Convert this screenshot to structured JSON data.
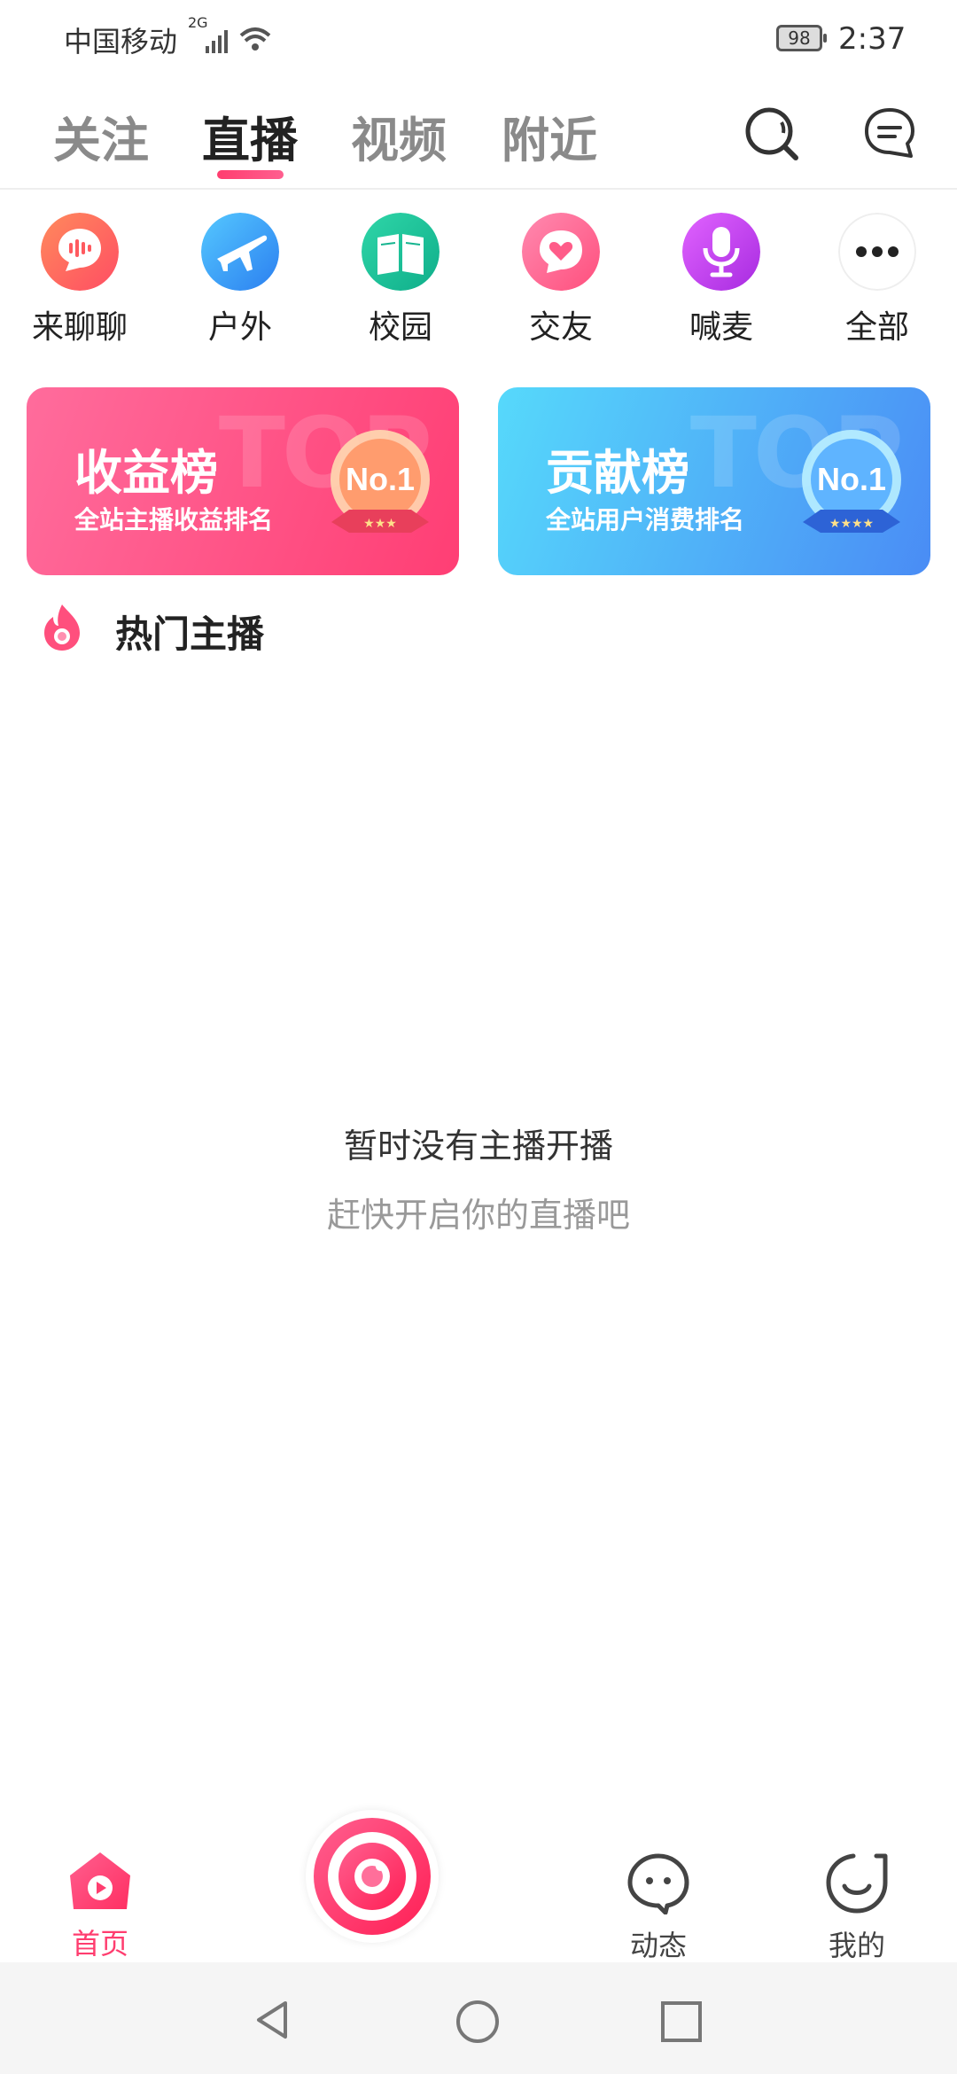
{
  "status_bar": {
    "carrier": "中国移动",
    "network": "2G",
    "battery": "98",
    "time": "2:37"
  },
  "top_nav": {
    "tabs": [
      {
        "label": "关注",
        "active": false
      },
      {
        "label": "直播",
        "active": true
      },
      {
        "label": "视频",
        "active": false
      },
      {
        "label": "附近",
        "active": false
      }
    ]
  },
  "categories": [
    {
      "label": "来聊聊",
      "icon": "chat-voice-icon",
      "color": "#ff6d4f"
    },
    {
      "label": "户外",
      "icon": "airplane-icon",
      "color": "#2e9cf5"
    },
    {
      "label": "校园",
      "icon": "book-icon",
      "color": "#18c29a"
    },
    {
      "label": "交友",
      "icon": "heart-chat-icon",
      "color": "#ff5c89"
    },
    {
      "label": "喊麦",
      "icon": "microphone-icon",
      "color": "#c53ef0"
    },
    {
      "label": "全部",
      "icon": "more-icon",
      "color": "#222222"
    }
  ],
  "banners": [
    {
      "title": "收益榜",
      "subtitle": "全站主播收益排名",
      "badge": "No.1",
      "watermark": "TOP"
    },
    {
      "title": "贡献榜",
      "subtitle": "全站用户消费排名",
      "badge": "No.1",
      "watermark": "TOP"
    }
  ],
  "hot_section": {
    "label": "热门主播"
  },
  "empty_state": {
    "line1": "暂时没有主播开播",
    "line2": "赶快开启你的直播吧"
  },
  "tab_bar": {
    "items": [
      {
        "label": "首页",
        "active": true
      },
      {
        "label": "动态",
        "active": false
      },
      {
        "label": "我的",
        "active": false
      }
    ]
  },
  "colors": {
    "accent": "#ff3d6f",
    "inactive_tab": "#8a8a8a"
  }
}
